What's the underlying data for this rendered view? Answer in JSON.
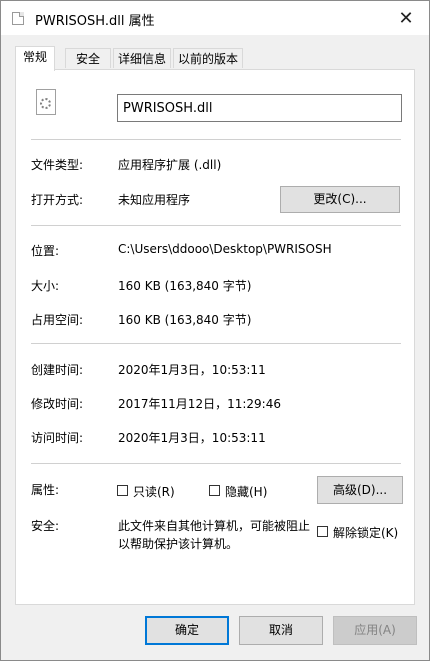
{
  "window": {
    "title": "PWRISOSH.dll 属性"
  },
  "tabs": [
    "常规",
    "安全",
    "详细信息",
    "以前的版本"
  ],
  "general": {
    "filename": "PWRISOSH.dll",
    "file_type_label": "文件类型:",
    "file_type_value": "应用程序扩展 (.dll)",
    "opens_with_label": "打开方式:",
    "opens_with_value": "未知应用程序",
    "change_button": "更改(C)...",
    "location_label": "位置:",
    "location_value": "C:\\Users\\ddooo\\Desktop\\PWRISOSH",
    "size_label": "大小:",
    "size_value": "160 KB (163,840 字节)",
    "size_on_disk_label": "占用空间:",
    "size_on_disk_value": "160 KB (163,840 字节)",
    "created_label": "创建时间:",
    "created_value": "2020年1月3日，10:53:11",
    "modified_label": "修改时间:",
    "modified_value": "2017年11月12日，11:29:46",
    "accessed_label": "访问时间:",
    "accessed_value": "2020年1月3日，10:53:11",
    "attributes_label": "属性:",
    "readonly_label": "只读(R)",
    "hidden_label": "隐藏(H)",
    "advanced_button": "高级(D)...",
    "security_label": "安全:",
    "security_text_1": "此文件来自其他计算机，可能被阻止",
    "security_text_2": "以帮助保护该计算机。",
    "unblock_label": "解除锁定(K)"
  },
  "footer": {
    "ok": "确定",
    "cancel": "取消",
    "apply": "应用(A)"
  },
  "icons": {
    "close": "close-icon",
    "file": "file-icon",
    "dll": "dll-gear-icon"
  }
}
